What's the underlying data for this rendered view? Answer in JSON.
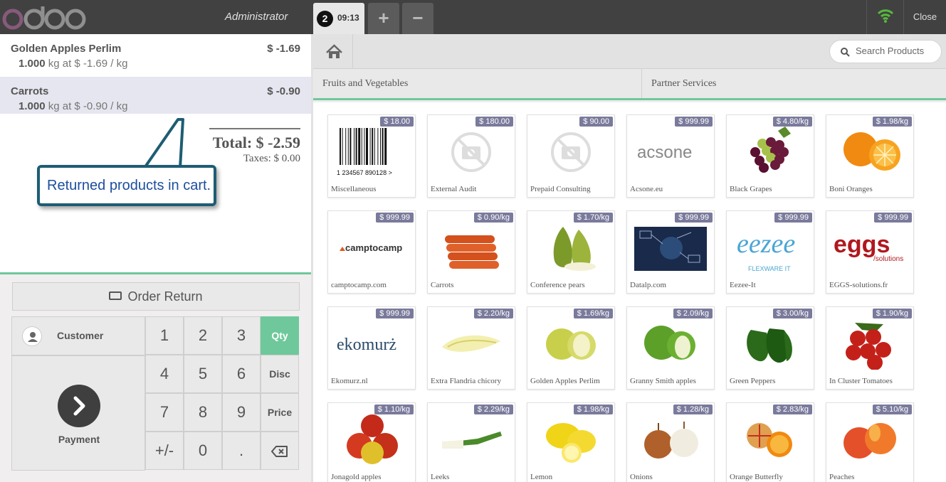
{
  "header": {
    "logo_text": "odoo",
    "cashier": "Administrator",
    "order_tab": {
      "number": "2",
      "time": "09:13"
    },
    "add_order_label": "+",
    "remove_order_label": "−",
    "close_label": "Close",
    "wifi_status": "connected"
  },
  "order": {
    "lines": [
      {
        "name": "Golden Apples Perlim",
        "price": "$ -1.69",
        "qty": "1.000",
        "unit_info": "kg at $ -1.69 / kg",
        "selected": false
      },
      {
        "name": "Carrots",
        "price": "$ -0.90",
        "qty": "1.000",
        "unit_info": "kg at $ -0.90 / kg",
        "selected": true
      }
    ],
    "total": "Total: $ -2.59",
    "taxes": "Taxes: $ 0.00",
    "callout": "Returned products in cart."
  },
  "actions": {
    "order_return": "Order Return",
    "customer": "Customer",
    "payment": "Payment"
  },
  "numpad": {
    "keys": [
      "1",
      "2",
      "3",
      "4",
      "5",
      "6",
      "7",
      "8",
      "9",
      "+/-",
      "0",
      "."
    ],
    "modes": [
      "Qty",
      "Disc",
      "Price"
    ],
    "active_mode": "Qty",
    "backspace_icon": "backspace-icon"
  },
  "search": {
    "placeholder": "Search Products"
  },
  "categories": [
    "Fruits and Vegetables",
    "Partner Services"
  ],
  "products": [
    {
      "name": "Miscellaneous",
      "price": "$ 18.00",
      "img": "barcode"
    },
    {
      "name": "External Audit",
      "price": "$ 180.00",
      "img": "noimage"
    },
    {
      "name": "Prepaid Consulting",
      "price": "$ 90.00",
      "img": "noimage"
    },
    {
      "name": "Acsone.eu",
      "price": "$ 999.99",
      "img": "acsone",
      "logo": "acsone"
    },
    {
      "name": "Black Grapes",
      "price": "$ 4.80/kg",
      "img": "grapes"
    },
    {
      "name": "Boni Oranges",
      "price": "$ 1.98/kg",
      "img": "oranges"
    },
    {
      "name": "camptocamp.com",
      "price": "$ 999.99",
      "img": "camptocamp",
      "logo": "camptocamp"
    },
    {
      "name": "Carrots",
      "price": "$ 0.90/kg",
      "img": "carrots"
    },
    {
      "name": "Conference pears",
      "price": "$ 1.70/kg",
      "img": "pears"
    },
    {
      "name": "Datalp.com",
      "price": "$ 999.99",
      "img": "datalp"
    },
    {
      "name": "Eezee-It",
      "price": "$ 999.99",
      "img": "eezee",
      "logo": "eezee",
      "logo2": "FLEXWARE IT"
    },
    {
      "name": "EGGS-solutions.fr",
      "price": "$ 999.99",
      "img": "eggs",
      "logo": "eggs",
      "logo2": "/solutions"
    },
    {
      "name": "Ekomurz.nl",
      "price": "$ 999.99",
      "img": "ekomurz",
      "logo": "ekomurż"
    },
    {
      "name": "Extra Flandria chicory",
      "price": "$ 2.20/kg",
      "img": "chicory"
    },
    {
      "name": "Golden Apples Perlim",
      "price": "$ 1.69/kg",
      "img": "golden"
    },
    {
      "name": "Granny Smith apples",
      "price": "$ 2.09/kg",
      "img": "granny"
    },
    {
      "name": "Green Peppers",
      "price": "$ 3.00/kg",
      "img": "peppers"
    },
    {
      "name": "In Cluster Tomatoes",
      "price": "$ 1.90/kg",
      "img": "tomatoes"
    },
    {
      "name": "Jonagold apples",
      "price": "$ 1.10/kg",
      "img": "jonagold"
    },
    {
      "name": "Leeks",
      "price": "$ 2.29/kg",
      "img": "leeks"
    },
    {
      "name": "Lemon",
      "price": "$ 1.98/kg",
      "img": "lemon"
    },
    {
      "name": "Onions",
      "price": "$ 1.28/kg",
      "img": "onions"
    },
    {
      "name": "Orange Butterfly",
      "price": "$ 2.83/kg",
      "img": "butterfly"
    },
    {
      "name": "Peaches",
      "price": "$ 5.10/kg",
      "img": "peaches"
    }
  ]
}
